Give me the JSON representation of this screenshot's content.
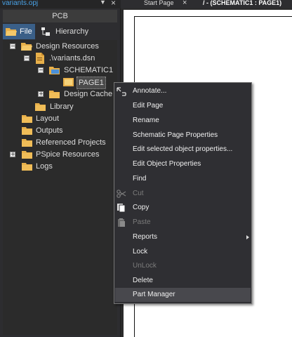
{
  "panel": {
    "window_title": "variants.opj",
    "header": "PCB",
    "tabs": [
      {
        "label": "File"
      },
      {
        "label": "Hierarchy"
      }
    ],
    "tree": [
      {
        "label": "Design Resources"
      },
      {
        "label": ".\\variants.dsn"
      },
      {
        "label": "SCHEMATIC1"
      },
      {
        "label": "PAGE1"
      },
      {
        "label": "Design Cache"
      },
      {
        "label": "Library"
      },
      {
        "label": "Layout"
      },
      {
        "label": "Outputs"
      },
      {
        "label": "Referenced Projects"
      },
      {
        "label": "PSpice Resources"
      },
      {
        "label": "Logs"
      }
    ]
  },
  "editor": {
    "tabs": [
      {
        "label": "Start Page"
      },
      {
        "label": "/ - (SCHEMATIC1 : PAGE1)"
      }
    ]
  },
  "context_menu": {
    "items": [
      {
        "label": "Annotate...",
        "icon": "annotate-icon",
        "enabled": true
      },
      {
        "label": "Edit Page",
        "enabled": true
      },
      {
        "label": "Rename",
        "enabled": true
      },
      {
        "label": "Schematic Page Properties",
        "enabled": true
      },
      {
        "label": "Edit selected object properties...",
        "enabled": true
      },
      {
        "label": "Edit Object Properties",
        "enabled": true
      },
      {
        "label": "Find",
        "enabled": true
      },
      {
        "label": "Cut",
        "icon": "scissors-icon",
        "enabled": false
      },
      {
        "label": "Copy",
        "icon": "copy-icon",
        "enabled": true
      },
      {
        "label": "Paste",
        "icon": "paste-icon",
        "enabled": false
      },
      {
        "label": "Reports",
        "enabled": true,
        "submenu": true
      },
      {
        "label": "Lock",
        "enabled": true
      },
      {
        "label": "UnLock",
        "enabled": false
      },
      {
        "label": "Delete",
        "enabled": true
      },
      {
        "label": "Part Manager",
        "enabled": true,
        "highlighted": true
      }
    ]
  },
  "colors": {
    "accent": "#4aa3e8",
    "folder": "#e8b04a",
    "selected_tab": "#3a5f88",
    "menu_bg": "#2f2f33"
  }
}
